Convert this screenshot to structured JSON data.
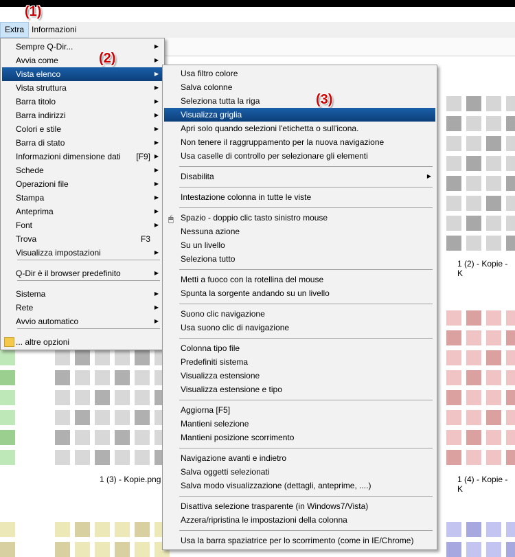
{
  "markers": {
    "m1": "(1)",
    "m2": "(2)",
    "m3": "(3)"
  },
  "menubar": {
    "extra": "Extra",
    "info": "Informazioni"
  },
  "captions": {
    "c1": "1 (2) - Kopie - K",
    "c2": "1 (3) - Kopie.png",
    "c3": "1 (4) - Kopie - K"
  },
  "main_menu": {
    "items": [
      {
        "label": "Sempre Q-Dir...",
        "arrow": "▶"
      },
      {
        "label": "Avvia come",
        "arrow": "▶"
      },
      {
        "label": "Vista elenco",
        "arrow": "▶"
      },
      {
        "label": "Vista struttura",
        "arrow": "▶"
      },
      {
        "label": "Barra titolo",
        "arrow": "▶"
      },
      {
        "label": "Barra indirizzi",
        "arrow": "▶"
      },
      {
        "label": "Colori e stile",
        "arrow": "▶"
      },
      {
        "label": "Barra di stato",
        "arrow": "▶"
      },
      {
        "label": "Informazioni dimensione dati",
        "shortcut": "[F9]",
        "arrow": "▶"
      },
      {
        "label": "Schede",
        "arrow": "▶"
      },
      {
        "label": "Operazioni file",
        "arrow": "▶"
      },
      {
        "label": "Stampa",
        "arrow": "▶"
      },
      {
        "label": "Anteprima",
        "arrow": "▶"
      },
      {
        "label": "Font",
        "arrow": "▶"
      },
      {
        "label": "Trova",
        "shortcut": "F3"
      },
      {
        "label": "Visualizza impostazioni",
        "arrow": "▶"
      },
      {
        "label": "Q-Dir è il browser predefinito",
        "arrow": "▶"
      },
      {
        "label": "Sistema",
        "arrow": "▶"
      },
      {
        "label": "Rete",
        "arrow": "▶"
      },
      {
        "label": "Avvio automatico",
        "arrow": "▶"
      },
      {
        "label": "... altre opzioni"
      }
    ]
  },
  "sub_menu": {
    "items": [
      {
        "label": "Usa filtro colore"
      },
      {
        "label": "Salva colonne"
      },
      {
        "label": "Seleziona tutta la riga"
      },
      {
        "label": "Visualizza griglia"
      },
      {
        "label": "Apri solo quando selezioni l'etichetta o sull'icona."
      },
      {
        "label": "Non tenere il raggruppamento per la nuova navigazione"
      },
      {
        "label": "Usa caselle di controllo per selezionare gli elementi"
      },
      {
        "label": "Disabilita",
        "arrow": "▶"
      },
      {
        "label": "Intestazione colonna in tutte le viste"
      },
      {
        "label": "Spazio - doppio clic tasto sinistro mouse",
        "icon": "mouse-icon"
      },
      {
        "label": "Nessuna azione"
      },
      {
        "label": "Su un livello"
      },
      {
        "label": "Seleziona tutto"
      },
      {
        "label": "Metti a fuoco con la rotellina del mouse"
      },
      {
        "label": "Spunta la sorgente andando su un livello"
      },
      {
        "label": "Suono clic navigazione"
      },
      {
        "label": "Usa suono clic di navigazione"
      },
      {
        "label": "Colonna tipo file"
      },
      {
        "label": "Predefiniti sistema"
      },
      {
        "label": "Visualizza estensione"
      },
      {
        "label": "Visualizza estensione e tipo"
      },
      {
        "label": "Aggiorna [F5]"
      },
      {
        "label": "Mantieni selezione"
      },
      {
        "label": "Mantieni posizione scorrimento"
      },
      {
        "label": "Navigazione avanti e indietro"
      },
      {
        "label": "Salva oggetti selezionati"
      },
      {
        "label": "Salva modo visualizzazione (dettagli, anteprime, ....)"
      },
      {
        "label": "Disattiva selezione trasparente (in Windows7/Vista)"
      },
      {
        "label": "Azzera/ripristina le impostazioni della colonna"
      },
      {
        "label": "Usa la barra spaziatrice per lo scorrimento (come in IE/Chrome)"
      }
    ]
  },
  "colors": {
    "highlight": "#0c4a8f",
    "marker": "#cc0000",
    "grid_gray": "#c8c8c8",
    "grid_green": "#a8dca0",
    "grid_red": "#e8a8a8",
    "grid_yellow": "#ece4a8",
    "grid_blue": "#b0b0e8"
  }
}
